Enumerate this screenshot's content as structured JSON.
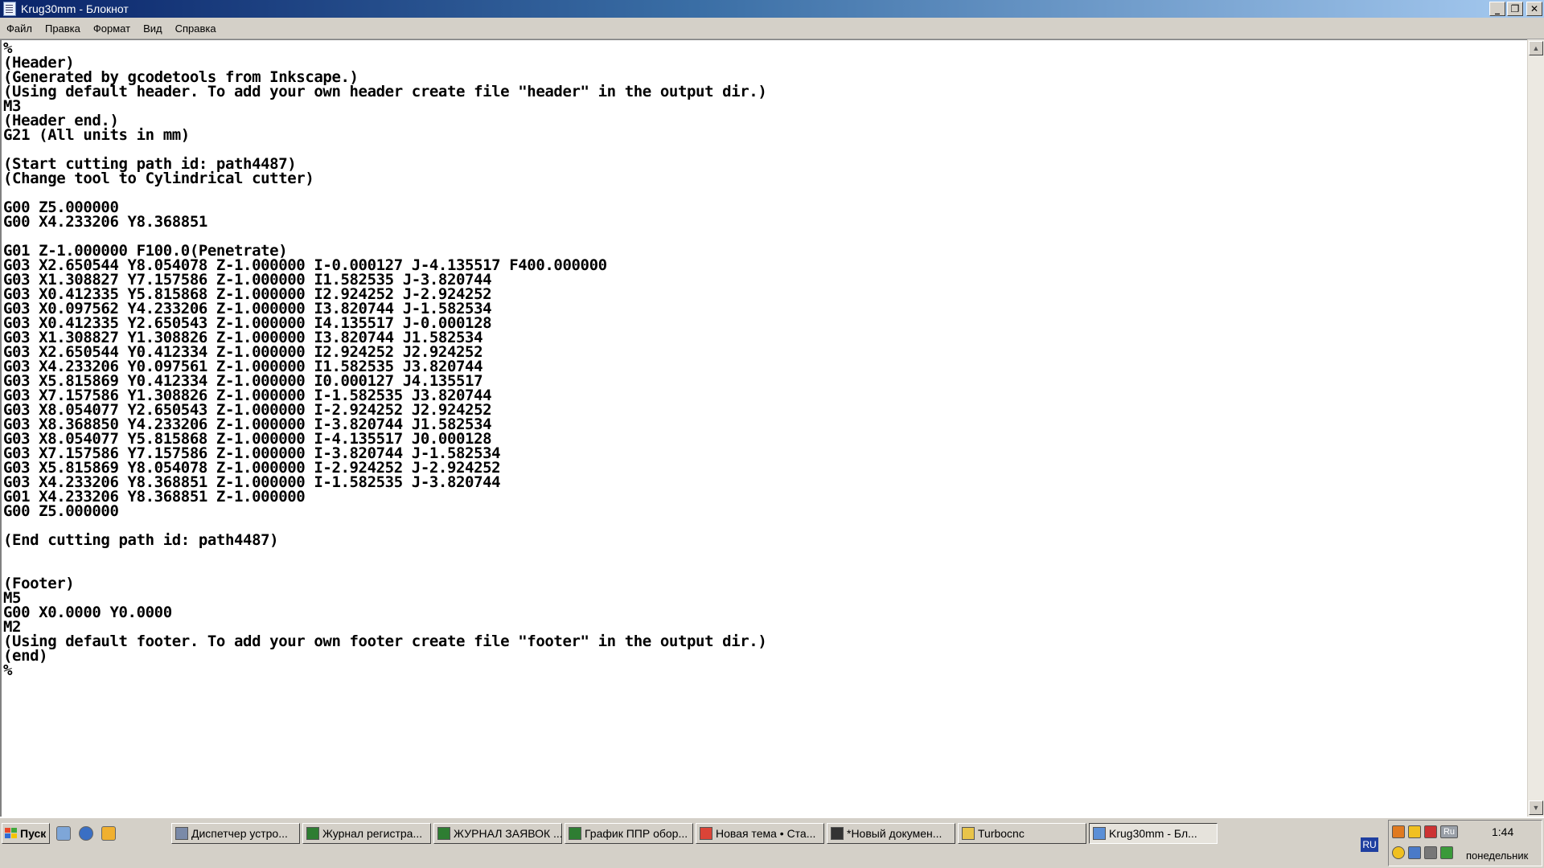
{
  "window": {
    "title": "Krug30mm - Блокнот",
    "buttons": {
      "minimize": "_",
      "restore": "❐",
      "close": "✕"
    }
  },
  "menu": [
    "Файл",
    "Правка",
    "Формат",
    "Вид",
    "Справка"
  ],
  "document": {
    "lines": [
      "%",
      "(Header)",
      "(Generated by gcodetools from Inkscape.)",
      "(Using default header. To add your own header create file \"header\" in the output dir.)",
      "M3",
      "(Header end.)",
      "G21 (All units in mm)",
      "",
      "(Start cutting path id: path4487)",
      "(Change tool to Cylindrical cutter)",
      "",
      "G00 Z5.000000",
      "G00 X4.233206 Y8.368851",
      "",
      "G01 Z-1.000000 F100.0(Penetrate)",
      "G03 X2.650544 Y8.054078 Z-1.000000 I-0.000127 J-4.135517 F400.000000",
      "G03 X1.308827 Y7.157586 Z-1.000000 I1.582535 J-3.820744",
      "G03 X0.412335 Y5.815868 Z-1.000000 I2.924252 J-2.924252",
      "G03 X0.097562 Y4.233206 Z-1.000000 I3.820744 J-1.582534",
      "G03 X0.412335 Y2.650543 Z-1.000000 I4.135517 J-0.000128",
      "G03 X1.308827 Y1.308826 Z-1.000000 I3.820744 J1.582534",
      "G03 X2.650544 Y0.412334 Z-1.000000 I2.924252 J2.924252",
      "G03 X4.233206 Y0.097561 Z-1.000000 I1.582535 J3.820744",
      "G03 X5.815869 Y0.412334 Z-1.000000 I0.000127 J4.135517",
      "G03 X7.157586 Y1.308826 Z-1.000000 I-1.582535 J3.820744",
      "G03 X8.054077 Y2.650543 Z-1.000000 I-2.924252 J2.924252",
      "G03 X8.368850 Y4.233206 Z-1.000000 I-3.820744 J1.582534",
      "G03 X8.054077 Y5.815868 Z-1.000000 I-4.135517 J0.000128",
      "G03 X7.157586 Y7.157586 Z-1.000000 I-3.820744 J-1.582534",
      "G03 X5.815869 Y8.054078 Z-1.000000 I-2.924252 J-2.924252",
      "G03 X4.233206 Y8.368851 Z-1.000000 I-1.582535 J-3.820744",
      "G01 X4.233206 Y8.368851 Z-1.000000",
      "G00 Z5.000000",
      "",
      "(End cutting path id: path4487)",
      "",
      "",
      "(Footer)",
      "M5",
      "G00 X0.0000 Y0.0000",
      "M2",
      "(Using default footer. To add your own footer create file \"footer\" in the output dir.)",
      "(end)",
      "%"
    ]
  },
  "scrollbar": {
    "up": "▲",
    "down": "▼"
  },
  "taskbar": {
    "start_label": "Пуск",
    "tasks": [
      {
        "label": "Диспетчер устро...",
        "icon": "device-manager-icon",
        "color": "#7a8aa8"
      },
      {
        "label": "Журнал регистра...",
        "icon": "excel-icon",
        "color": "#2e7d32"
      },
      {
        "label": "ЖУРНАЛ ЗАЯВОК ...",
        "icon": "excel-icon",
        "color": "#2e7d32"
      },
      {
        "label": "График ППР обор...",
        "icon": "excel-icon",
        "color": "#2e7d32"
      },
      {
        "label": "Новая тема • Ста...",
        "icon": "chrome-icon",
        "color": "#db4437"
      },
      {
        "label": "*Новый докумен...",
        "icon": "inkscape-icon",
        "color": "#333333"
      },
      {
        "label": "Turbocnc",
        "icon": "folder-icon",
        "color": "#e8c44a"
      },
      {
        "label": "Krug30mm - Бл...",
        "icon": "notepad-icon",
        "color": "#5b8fd6"
      }
    ],
    "language": "RU",
    "tray_language": "Ru",
    "clock": {
      "time": "1:44",
      "day": "понедельник"
    }
  }
}
